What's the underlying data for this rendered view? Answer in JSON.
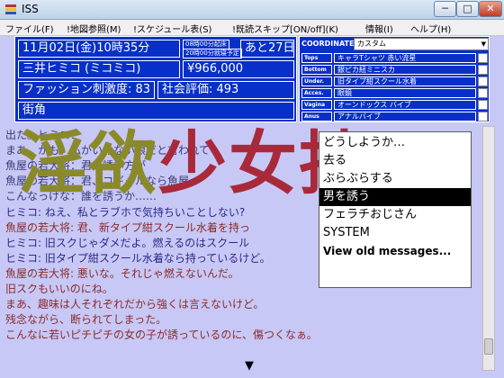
{
  "window": {
    "title": "ISS",
    "buttons": {
      "minimize": "─",
      "maximize": "□",
      "close": "✕"
    }
  },
  "menu": [
    "ファイル(F)",
    "!地図参照(M)",
    "!スケジュール表(S)",
    "!既読スキップ[ON/off](K)",
    "情報(I)",
    "ヘルプ(H)"
  ],
  "status": {
    "date": "11月02日(金)10時35分",
    "open_time": "08時00分起床",
    "close_time": "20時00分就寝予定",
    "days_left": "あと27日",
    "name": "三井ヒミコ (ミコミコ)",
    "money": "¥966,000",
    "fashion": "ファッション刺激度: 83",
    "social": "社会評価: 493",
    "location": "街角"
  },
  "equipment": {
    "coordinate_label": "COORDINATE:",
    "coordinate_value": "カスタム",
    "slots": [
      {
        "label": "Tops",
        "value": "キャラTシャツ 赤い流星"
      },
      {
        "label": "Bottom",
        "value": "銀ピカ紐ミニスカ"
      },
      {
        "label": "Under.",
        "value": "旧タイプ紺スクール水着"
      },
      {
        "label": "Acces.",
        "value": "眼鏡"
      },
      {
        "label": "Vagina",
        "value": "オーンドックス バイブ"
      },
      {
        "label": "Anus",
        "value": "アナルバイブ"
      }
    ]
  },
  "dialogue": [
    {
      "text": "出た。ヒミコ：",
      "color": "#3a3a7a"
    },
    {
      "text": "まあ、かも。私がいけない娘だと言われて",
      "color": "#3a3a7a"
    },
    {
      "text": "魚屋の若大将：君が誘い方が",
      "color": "#3a3a7a"
    },
    {
      "text": "魚屋の若大将：君、コギャルなら魚屋",
      "color": "#3a3a7a"
    },
    {
      "text": "こんなっけな：誰を誘うか……",
      "color": "#3a3a7a"
    },
    {
      "text": "ヒミコ: ねえ、私とラブホで気持ちいことしない?",
      "color": "#2a2a8a"
    },
    {
      "text": "魚屋の若大将: 君、新タイプ紺スクール水着を持っ",
      "color": "#8a2a2a"
    },
    {
      "text": "ヒミコ: 旧スクじゃダメだよ。燃えるのはスクール",
      "color": "#2a2a8a"
    },
    {
      "text": "ヒミコ: 旧タイプ紺スクール水着なら持っているけど。",
      "color": "#2a2a8a"
    },
    {
      "text": "魚屋の若大将: 悪いな。それじゃ燃えないんだ。",
      "color": "#8a2a2a"
    },
    {
      "text": "旧スクもいいのにね。",
      "color": "#8a2a2a"
    },
    {
      "text": "まあ、趣味は人それぞれだから強くは言えないけど。",
      "color": "#8a2a2a"
    },
    {
      "text": "残念ながら、断られてしまった。",
      "color": "#8a2a2a"
    },
    {
      "text": "こんなに若いピチピチの女の子が誘っているのに、傷つくなぁ。",
      "color": "#8a2a2a"
    }
  ],
  "logo": {
    "part1": "淫欲",
    "part2": "少女抄"
  },
  "choices": [
    {
      "label": "どうしようか…",
      "selected": false,
      "bold": false
    },
    {
      "label": "去る",
      "selected": false,
      "bold": false
    },
    {
      "label": "ぶらぶらする",
      "selected": false,
      "bold": false
    },
    {
      "label": "男を誘う",
      "selected": true,
      "bold": false
    },
    {
      "label": "フェラチおじさん",
      "selected": false,
      "bold": false
    },
    {
      "label": "SYSTEM",
      "selected": false,
      "bold": false
    },
    {
      "label": "View old messages...",
      "selected": false,
      "bold": true
    }
  ],
  "next_indicator": "▼"
}
